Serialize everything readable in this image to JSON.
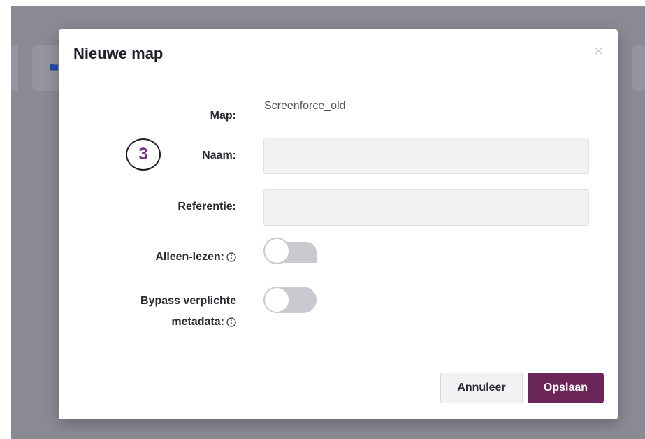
{
  "modal": {
    "title": "Nieuwe map",
    "close_icon": "close-icon"
  },
  "form": {
    "map_label": "Map:",
    "map_value": "Screenforce_old",
    "naam_label": "Naam:",
    "naam_value": "",
    "referentie_label": "Referentie:",
    "referentie_value": "",
    "alleen_lezen_label": "Alleen-lezen:",
    "alleen_lezen_on": false,
    "bypass_label_line1": "Bypass verplichte",
    "bypass_label_line2": "metadata:",
    "bypass_on": false
  },
  "annotation": {
    "step_number": "3"
  },
  "buttons": {
    "cancel_label": "Annuleer",
    "save_label": "Opslaan"
  },
  "colors": {
    "primary": "#6b2558",
    "backdrop": "#8a8a95",
    "toggle_off": "#c9c9cf",
    "step_badge_text": "#7a2e8e",
    "folder_icon": "#1e4aa8"
  }
}
